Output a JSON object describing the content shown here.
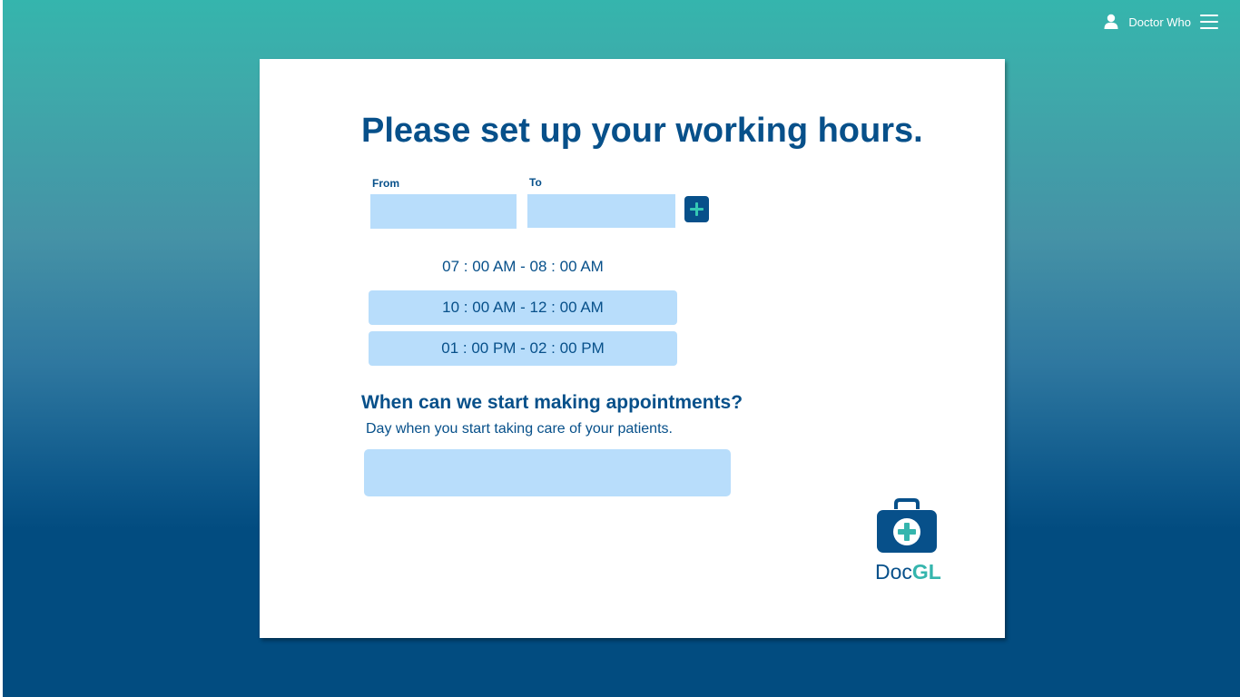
{
  "header": {
    "user_name": "Doctor Who",
    "user_icon": "user-icon",
    "menu_icon": "hamburger-menu-icon"
  },
  "working_hours": {
    "title": "Please set up your working hours.",
    "from_label": "From",
    "to_label": "To",
    "from_value": "",
    "to_value": "",
    "add_icon": "plus-icon",
    "slots": [
      "07 : 00 AM - 08 : 00 AM",
      "10 : 00 AM - 12 : 00 AM",
      "01 : 00 PM - 02 : 00 PM"
    ]
  },
  "appointments": {
    "title": "When can we start making appointments?",
    "subtitle": "Day when you start taking care of your patients.",
    "start_date_value": ""
  },
  "logo": {
    "text_doc": "Doc",
    "text_gl": "GL",
    "icon": "medical-kit-icon"
  },
  "colors": {
    "primary": "#07508a",
    "accent": "#35b5ad",
    "field": "#b8ddfb",
    "background_top": "#35b5ad",
    "background_bottom": "#024c80"
  }
}
